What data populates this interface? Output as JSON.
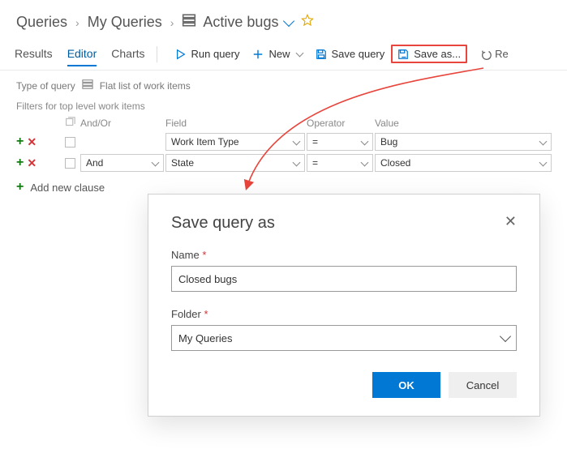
{
  "breadcrumb": {
    "root": "Queries",
    "folder": "My Queries",
    "current": "Active bugs"
  },
  "tabs": {
    "results": "Results",
    "editor": "Editor",
    "charts": "Charts"
  },
  "toolbar": {
    "run": "Run query",
    "new": "New",
    "save": "Save query",
    "saveas": "Save as...",
    "re": "Re"
  },
  "querytype": {
    "label": "Type of query",
    "value": "Flat list of work items"
  },
  "filters": {
    "caption": "Filters for top level work items",
    "headers": {
      "andor": "And/Or",
      "field": "Field",
      "operator": "Operator",
      "value": "Value"
    },
    "rows": [
      {
        "andor": "",
        "field": "Work Item Type",
        "operator": "=",
        "value": "Bug"
      },
      {
        "andor": "And",
        "field": "State",
        "operator": "=",
        "value": "Closed"
      }
    ],
    "add": "Add new clause"
  },
  "dialog": {
    "title": "Save query as",
    "name_label": "Name",
    "name_value": "Closed bugs",
    "folder_label": "Folder",
    "folder_value": "My Queries",
    "ok": "OK",
    "cancel": "Cancel"
  }
}
